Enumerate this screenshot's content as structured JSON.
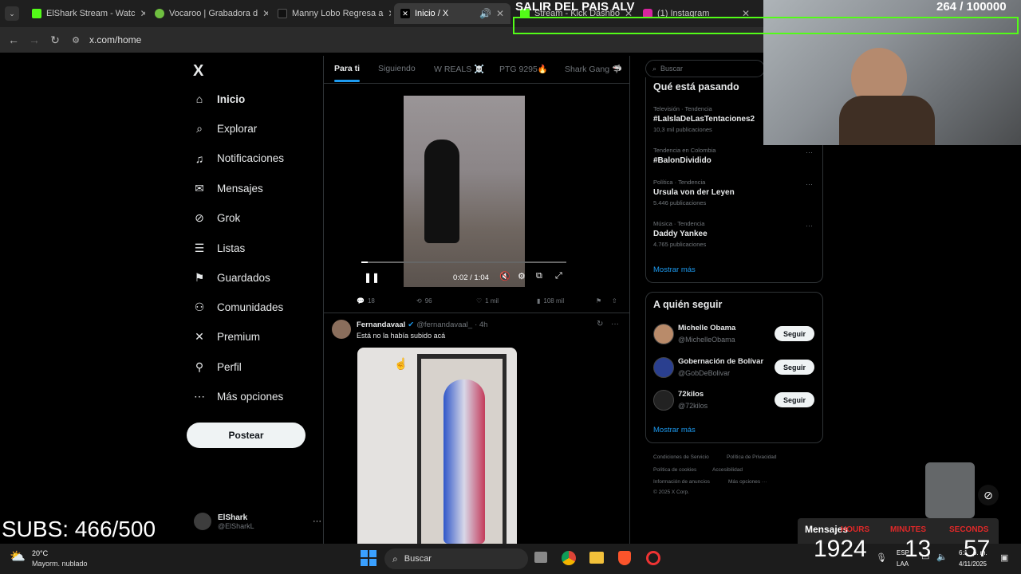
{
  "browser": {
    "tabs": [
      {
        "label": "ElShark Stream - Watc",
        "color": "#53fc18",
        "active": false
      },
      {
        "label": "Vocaroo | Grabadora d",
        "color": "#6fbf40",
        "active": false
      },
      {
        "label": "Manny Lobo Regresa a",
        "color": "#111111",
        "active": false
      },
      {
        "label": "Inicio / X",
        "color": "#000000",
        "active": true
      },
      {
        "label": "Stream - Kick Dashbo",
        "color": "#53fc18",
        "active": false
      },
      {
        "label": "(1) Instagram",
        "color": "#d6249f",
        "active": false
      }
    ],
    "url": "x.com/home"
  },
  "sidebar": {
    "logo": "X",
    "items": [
      {
        "label": "Inicio",
        "icon": "home-icon",
        "glyph": "⌂"
      },
      {
        "label": "Explorar",
        "icon": "search-icon",
        "glyph": "⌕"
      },
      {
        "label": "Notificaciones",
        "icon": "bell-icon",
        "glyph": "♫"
      },
      {
        "label": "Mensajes",
        "icon": "mail-icon",
        "glyph": "✉"
      },
      {
        "label": "Grok",
        "icon": "grok-icon",
        "glyph": "⊘"
      },
      {
        "label": "Listas",
        "icon": "list-icon",
        "glyph": "☰"
      },
      {
        "label": "Guardados",
        "icon": "bookmark-icon",
        "glyph": "⚑"
      },
      {
        "label": "Comunidades",
        "icon": "people-icon",
        "glyph": "⚇"
      },
      {
        "label": "Premium",
        "icon": "x-icon",
        "glyph": "✕"
      },
      {
        "label": "Perfil",
        "icon": "person-icon",
        "glyph": "⚲"
      },
      {
        "label": "Más opciones",
        "icon": "more-circle-icon",
        "glyph": "⋯"
      }
    ],
    "post_label": "Postear",
    "account": {
      "name": "ElShark",
      "handle": "@ElSharkL"
    }
  },
  "feed": {
    "tabs": [
      "Para ti",
      "Siguiendo",
      "W REALS ☠️",
      "PTG 9295🔥",
      "Shark Gang 🦈"
    ],
    "video": {
      "time": "0:02 / 1:04",
      "progress": 0.03
    },
    "post1_stats": {
      "replies": "18",
      "reposts": "96",
      "likes": "1 mil",
      "views": "108 mil"
    },
    "post2": {
      "name": "Fernandavaal",
      "handle": "@fernandavaal_",
      "time": "· 4h",
      "text": "Está no la había subido acá"
    }
  },
  "right": {
    "search_placeholder": "Buscar",
    "trends_title": "Qué está pasando",
    "trends": [
      {
        "context": "Televisión · Tendencia",
        "name": "#LaIslaDeLasTentaciones2",
        "count": "10,3 mil publicaciones"
      },
      {
        "context": "Tendencia en Colombia",
        "name": "#BalonDividido",
        "count": ""
      },
      {
        "context": "Política · Tendencia",
        "name": "Ursula von der Leyen",
        "count": "5.446 publicaciones"
      },
      {
        "context": "Música · Tendencia",
        "name": "Daddy Yankee",
        "count": "4.765 publicaciones"
      }
    ],
    "show_more": "Mostrar más",
    "who_title": "A quién seguir",
    "who": [
      {
        "name": "Michelle Obama",
        "handle": "@MichelleObama",
        "button": "Seguir"
      },
      {
        "name": "Gobernación de Bolívar",
        "handle": "@GobDeBolivar",
        "button": "Seguir"
      },
      {
        "name": "72kilos",
        "handle": "@72kilos",
        "button": "Seguir"
      }
    ],
    "who_more": "Mostrar más",
    "footer": [
      "Condiciones de Servicio",
      "Política de Privacidad",
      "Política de cookies",
      "Accesibilidad",
      "Información de anuncios",
      "Más opciones ···",
      "© 2025 X Corp."
    ]
  },
  "overlay": {
    "top_title": "SALIR DEL PAIS ALV",
    "counter": "264  / 100000",
    "subs": "SUBS: 466/500",
    "messages_label": "Mensajes",
    "timer": {
      "hours_label": "HOURS",
      "minutes_label": "MINUTES",
      "seconds_label": "SECONDS",
      "hours": "1924",
      "minutes": "13",
      "seconds": "57"
    }
  },
  "taskbar": {
    "weather_temp": "20°C",
    "weather_desc": "Mayorm. nublado",
    "search": "Buscar",
    "lang": "ESP",
    "lang2": "LAA",
    "time": "6:1_ p. m.",
    "date": "4/11/2025"
  }
}
